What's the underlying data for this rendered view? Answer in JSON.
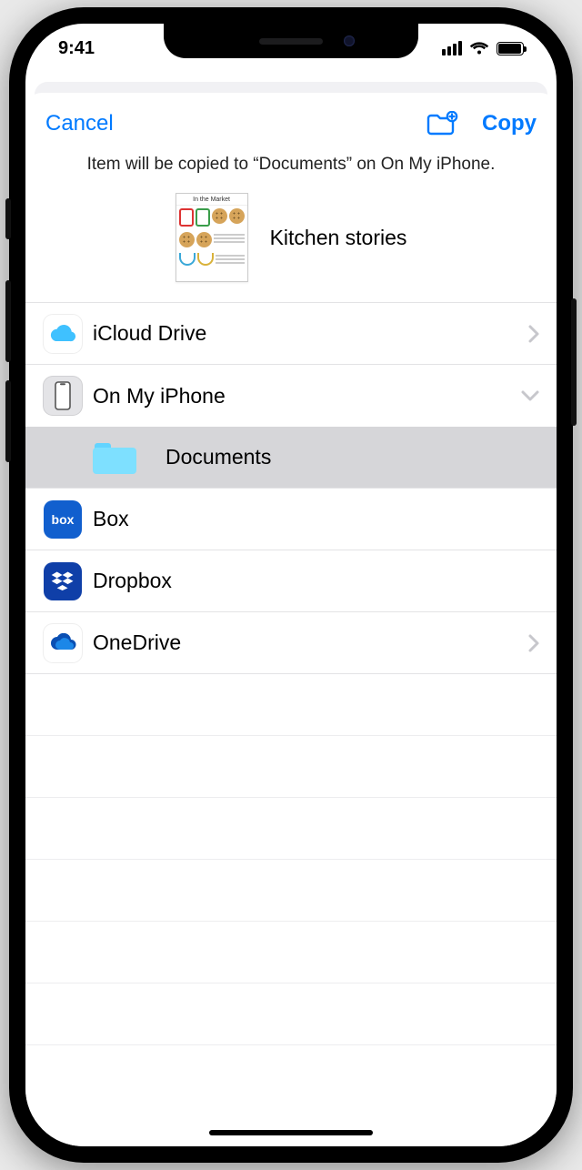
{
  "status": {
    "time": "9:41"
  },
  "nav": {
    "cancel": "Cancel",
    "copy": "Copy"
  },
  "subtitle": "Item will be copied to “Documents” on On My iPhone.",
  "item": {
    "name": "Kitchen stories",
    "thumb_header": "In the Market"
  },
  "locations": {
    "icloud": "iCloud Drive",
    "onmyiphone": "On My iPhone",
    "documents": "Documents",
    "box": "Box",
    "dropbox": "Dropbox",
    "onedrive": "OneDrive"
  },
  "box_label": "box"
}
